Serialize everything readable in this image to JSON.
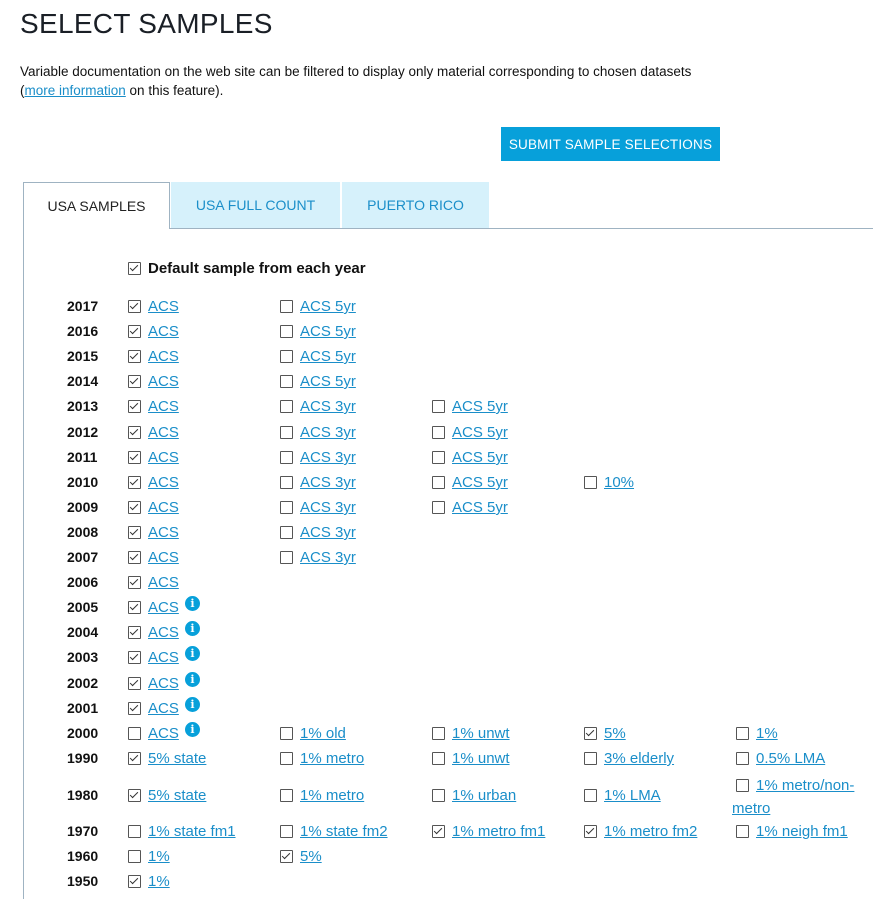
{
  "page": {
    "title": "SELECT SAMPLES",
    "intro_before": "Variable documentation on the web site can be filtered to display only material corresponding to chosen datasets (",
    "intro_link": "more information",
    "intro_after": " on this feature).",
    "submit_label": "SUBMIT SAMPLE SELECTIONS"
  },
  "tabs": [
    {
      "label": "USA SAMPLES",
      "active": true
    },
    {
      "label": "USA FULL COUNT",
      "active": false
    },
    {
      "label": "PUERTO RICO",
      "active": false
    }
  ],
  "default_sample": {
    "label": "Default sample from each year",
    "checked": true
  },
  "rows": [
    {
      "year": "2017",
      "samples": [
        {
          "label": "ACS",
          "checked": true
        },
        {
          "label": "ACS 5yr",
          "checked": false
        }
      ]
    },
    {
      "year": "2016",
      "samples": [
        {
          "label": "ACS",
          "checked": true
        },
        {
          "label": "ACS 5yr",
          "checked": false
        }
      ]
    },
    {
      "year": "2015",
      "samples": [
        {
          "label": "ACS",
          "checked": true
        },
        {
          "label": "ACS 5yr",
          "checked": false
        }
      ]
    },
    {
      "year": "2014",
      "samples": [
        {
          "label": "ACS",
          "checked": true
        },
        {
          "label": "ACS 5yr",
          "checked": false
        }
      ]
    },
    {
      "year": "2013",
      "samples": [
        {
          "label": "ACS",
          "checked": true
        },
        {
          "label": "ACS 3yr",
          "checked": false
        },
        {
          "label": "ACS 5yr",
          "checked": false
        }
      ]
    },
    {
      "year": "2012",
      "samples": [
        {
          "label": "ACS",
          "checked": true
        },
        {
          "label": "ACS 3yr",
          "checked": false
        },
        {
          "label": "ACS 5yr",
          "checked": false
        }
      ]
    },
    {
      "year": "2011",
      "samples": [
        {
          "label": "ACS",
          "checked": true
        },
        {
          "label": "ACS 3yr",
          "checked": false
        },
        {
          "label": "ACS 5yr",
          "checked": false
        }
      ]
    },
    {
      "year": "2010",
      "samples": [
        {
          "label": "ACS",
          "checked": true
        },
        {
          "label": "ACS 3yr",
          "checked": false
        },
        {
          "label": "ACS 5yr",
          "checked": false
        },
        {
          "label": "10%",
          "checked": false
        }
      ]
    },
    {
      "year": "2009",
      "samples": [
        {
          "label": "ACS",
          "checked": true
        },
        {
          "label": "ACS 3yr",
          "checked": false
        },
        {
          "label": "ACS 5yr",
          "checked": false
        }
      ]
    },
    {
      "year": "2008",
      "samples": [
        {
          "label": "ACS",
          "checked": true
        },
        {
          "label": "ACS 3yr",
          "checked": false
        }
      ]
    },
    {
      "year": "2007",
      "samples": [
        {
          "label": "ACS",
          "checked": true
        },
        {
          "label": "ACS 3yr",
          "checked": false
        }
      ]
    },
    {
      "year": "2006",
      "samples": [
        {
          "label": "ACS",
          "checked": true
        }
      ]
    },
    {
      "year": "2005",
      "samples": [
        {
          "label": "ACS",
          "checked": true,
          "info": true
        }
      ]
    },
    {
      "year": "2004",
      "samples": [
        {
          "label": "ACS",
          "checked": true,
          "info": true
        }
      ]
    },
    {
      "year": "2003",
      "samples": [
        {
          "label": "ACS",
          "checked": true,
          "info": true
        }
      ]
    },
    {
      "year": "2002",
      "samples": [
        {
          "label": "ACS",
          "checked": true,
          "info": true
        }
      ]
    },
    {
      "year": "2001",
      "samples": [
        {
          "label": "ACS",
          "checked": true,
          "info": true
        }
      ]
    },
    {
      "year": "2000",
      "samples": [
        {
          "label": "ACS",
          "checked": false,
          "info": true
        },
        {
          "label": "1% old",
          "checked": false
        },
        {
          "label": "1% unwt",
          "checked": false
        },
        {
          "label": "5%",
          "checked": true
        },
        {
          "label": "1%",
          "checked": false
        }
      ]
    },
    {
      "year": "1990",
      "samples": [
        {
          "label": "5% state",
          "checked": true
        },
        {
          "label": "1% metro",
          "checked": false
        },
        {
          "label": "1% unwt",
          "checked": false
        },
        {
          "label": "3% elderly",
          "checked": false
        },
        {
          "label": "0.5% LMA",
          "checked": false
        }
      ]
    },
    {
      "year": "1980",
      "samples": [
        {
          "label": "5% state",
          "checked": true
        },
        {
          "label": "1% metro",
          "checked": false
        },
        {
          "label": "1% urban",
          "checked": false
        },
        {
          "label": "1% LMA",
          "checked": false
        },
        {
          "label": "1% metro/non-",
          "label2": "metro",
          "checked": false
        }
      ]
    },
    {
      "year": "1970",
      "samples": [
        {
          "label": "1% state fm1",
          "checked": false
        },
        {
          "label": "1% state fm2",
          "checked": false
        },
        {
          "label": "1% metro fm1",
          "checked": true
        },
        {
          "label": "1% metro fm2",
          "checked": true
        },
        {
          "label": "1% neigh fm1",
          "checked": false
        }
      ]
    },
    {
      "year": "1960",
      "samples": [
        {
          "label": "1%",
          "checked": false
        },
        {
          "label": "5%",
          "checked": true
        }
      ]
    },
    {
      "year": "1950",
      "samples": [
        {
          "label": "1%",
          "checked": true
        }
      ]
    }
  ],
  "colors": {
    "accent": "#07a0da",
    "link": "#1a8ec9",
    "tab_inactive_bg": "#d6f1fb"
  }
}
